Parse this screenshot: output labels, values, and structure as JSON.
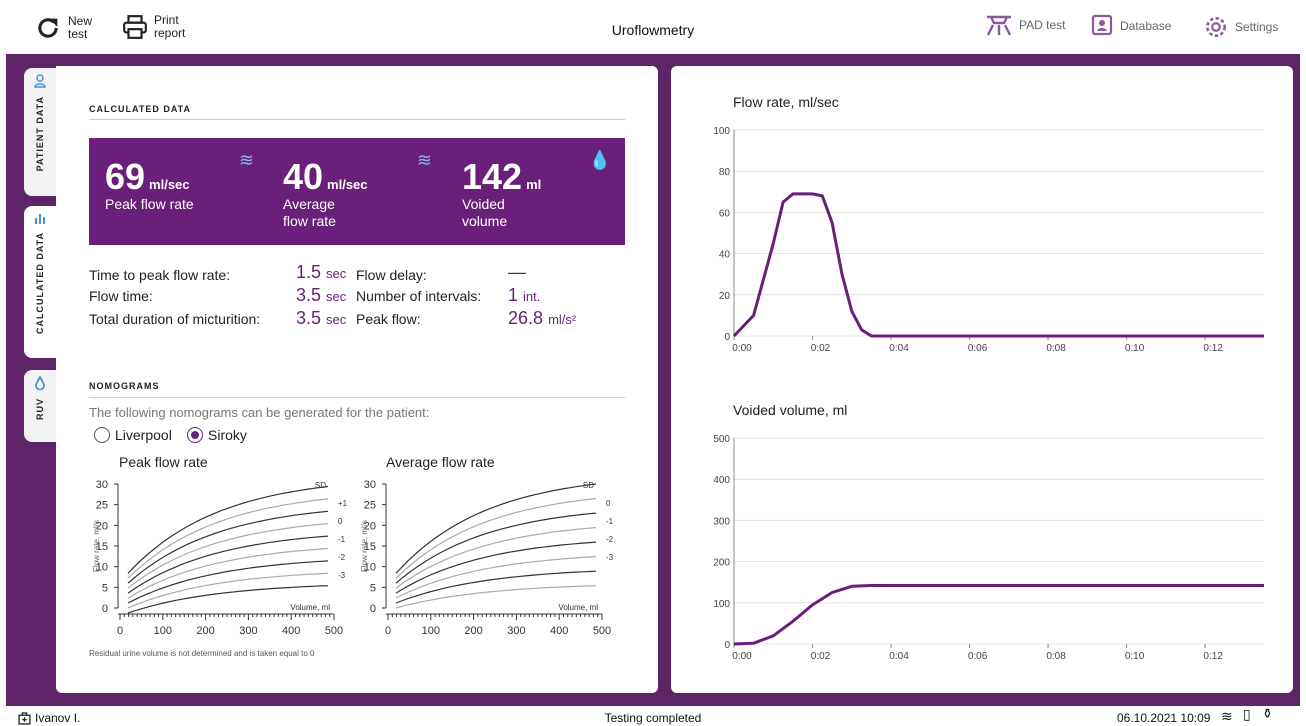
{
  "toolbar": {
    "new_test": "New test",
    "print_report": "Print report",
    "title": "Uroflowmetry",
    "pad_test": "PAD test",
    "database": "Database",
    "settings": "Settings"
  },
  "tabs": {
    "patient": "PATIENT DATA",
    "calculated": "CALCULATED DATA",
    "ruv": "RUV"
  },
  "calculated": {
    "section_title": "CALCULATED DATA",
    "cards": [
      {
        "value": "69",
        "unit": "ml/sec",
        "label_line1": "Peak flow rate",
        "label_line2": "",
        "icon": "wave-icon"
      },
      {
        "value": "40",
        "unit": "ml/sec",
        "label_line1": "Average",
        "label_line2": "flow rate",
        "icon": "wave-icon"
      },
      {
        "value": "142",
        "unit": "ml",
        "label_line1": "Voided",
        "label_line2": "volume",
        "icon": "drop-icon"
      }
    ],
    "rows": [
      {
        "label": "Time to peak flow rate:",
        "value": "1.5",
        "unit": "sec",
        "label2": "Flow delay:",
        "value2": "—",
        "unit2": ""
      },
      {
        "label": "Flow time:",
        "value": "3.5",
        "unit": "sec",
        "label2": "Number of intervals:",
        "value2": "1",
        "unit2": "int."
      },
      {
        "label": "Total duration of micturition:",
        "value": "3.5",
        "unit": "sec",
        "label2": "Peak flow:",
        "value2": "26.8",
        "unit2": "ml/s²"
      }
    ]
  },
  "nomograms": {
    "section_title": "NOMOGRAMS",
    "description": "The following nomograms can be generated for the patient:",
    "options": [
      "Liverpool",
      "Siroky"
    ],
    "selected": "Siroky",
    "peak_title": "Peak flow rate",
    "avg_title": "Average flow rate",
    "ylabel": "Flow rate, ml/s",
    "xlabel": "Volume, ml",
    "yticks": [
      "30",
      "25",
      "20",
      "15",
      "10",
      "5",
      "0"
    ],
    "xticks": [
      "0",
      "100",
      "200",
      "300",
      "400",
      "500"
    ],
    "peak_sd": [
      "SD",
      "+1",
      "0",
      "-1",
      "-2",
      "-3"
    ],
    "avg_sd": [
      "SD",
      "0",
      "-1",
      "-2",
      "-3"
    ],
    "footnote": "Residual urine volume is not determined and is taken equal to 0"
  },
  "chart_data": [
    {
      "type": "line",
      "title": "Flow rate, ml/sec",
      "x_ticks": [
        "0:00",
        "0:02",
        "0:04",
        "0:06",
        "0:08",
        "0:10",
        "0:12"
      ],
      "y_ticks": [
        "100",
        "80",
        "60",
        "40",
        "20",
        "0"
      ],
      "ylim": [
        0,
        100
      ],
      "series": [
        {
          "x": [
            0,
            0.5,
            1.0,
            1.25,
            1.5,
            1.75,
            2.0,
            2.25,
            2.5,
            2.75,
            3.0,
            3.25,
            3.5,
            4,
            13.5
          ],
          "values": [
            0,
            10,
            45,
            65,
            69,
            69,
            69,
            68,
            55,
            30,
            12,
            3,
            0,
            0,
            0
          ]
        }
      ],
      "color": "#6a1f7a"
    },
    {
      "type": "line",
      "title": "Voided volume, ml",
      "x_ticks": [
        "0:00",
        "0:02",
        "0:04",
        "0:06",
        "0:08",
        "0:10",
        "0:12"
      ],
      "y_ticks": [
        "500",
        "400",
        "300",
        "200",
        "100",
        "0"
      ],
      "ylim": [
        0,
        500
      ],
      "series": [
        {
          "x": [
            0,
            0.5,
            1.0,
            1.5,
            2.0,
            2.5,
            3.0,
            3.5,
            13.5
          ],
          "values": [
            0,
            2,
            20,
            55,
            95,
            125,
            140,
            142,
            142
          ]
        }
      ],
      "color": "#6a1f7a"
    }
  ],
  "status": {
    "user": "Ivanov I.",
    "message": "Testing completed",
    "datetime": "06.10.2021 10:09"
  }
}
